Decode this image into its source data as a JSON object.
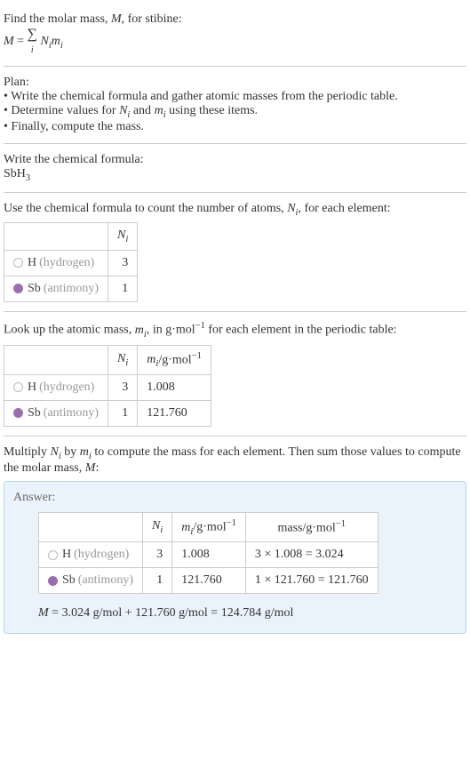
{
  "intro": {
    "line1_prefix": "Find the molar mass, ",
    "line1_var": "M",
    "line1_suffix": ", for stibine:",
    "eq_lhs": "M",
    "eq_rhs_pre": " = ",
    "eq_sum": "∑",
    "eq_sum_sub": "i",
    "eq_term1": "N",
    "eq_term1_sub": "i",
    "eq_term2": "m",
    "eq_term2_sub": "i"
  },
  "plan": {
    "title": "Plan:",
    "b1_pre": "• Write the chemical formula and gather atomic masses from the periodic table.",
    "b2_pre": "• Determine values for ",
    "b2_n": "N",
    "b2_ni": "i",
    "b2_mid": " and ",
    "b2_m": "m",
    "b2_mi": "i",
    "b2_post": " using these items.",
    "b3": "• Finally, compute the mass."
  },
  "chem": {
    "title": "Write the chemical formula:",
    "formula_base": "SbH",
    "formula_sub": "3"
  },
  "count": {
    "text_pre": "Use the chemical formula to count the number of atoms, ",
    "var": "N",
    "var_sub": "i",
    "text_post": ", for each element:",
    "header_n": "N",
    "header_n_sub": "i",
    "rows": [
      {
        "color": "#ffffff",
        "border": "#bbb",
        "sym": "H",
        "name": "(hydrogen)",
        "n": "3"
      },
      {
        "color": "#9a6fb0",
        "border": "#9a6fb0",
        "sym": "Sb",
        "name": "(antimony)",
        "n": "1"
      }
    ]
  },
  "mass": {
    "text_pre": "Look up the atomic mass, ",
    "var": "m",
    "var_sub": "i",
    "text_mid": ", in g·mol",
    "text_sup": "−1",
    "text_post": " for each element in the periodic table:",
    "header_m_pre": "m",
    "header_m_sub": "i",
    "header_m_unit": "/g·mol",
    "header_m_sup": "−1",
    "rows": [
      {
        "m": "1.008"
      },
      {
        "m": "121.760"
      }
    ]
  },
  "multiply": {
    "text_pre": "Multiply ",
    "n": "N",
    "ni": "i",
    "mid1": " by ",
    "m": "m",
    "mi": "i",
    "mid2": " to compute the mass for each element. Then sum those values to compute the molar mass, ",
    "mvar": "M",
    "post": ":"
  },
  "answer": {
    "label": "Answer:",
    "mass_header": "mass/g·mol",
    "mass_header_sup": "−1",
    "rows": [
      {
        "calc": "3 × 1.008 = 3.024"
      },
      {
        "calc": "1 × 121.760 = 121.760"
      }
    ],
    "final_pre": "M",
    "final_text": " = 3.024 g/mol + 121.760 g/mol = 124.784 g/mol"
  }
}
